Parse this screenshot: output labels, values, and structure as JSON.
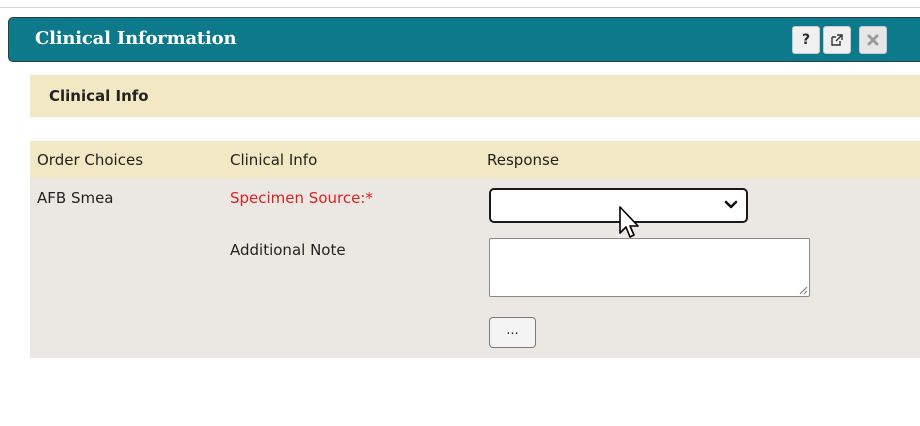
{
  "dialog": {
    "title": "Clinical Information",
    "buttons": {
      "help_label": "?",
      "popout_icon": "popout-icon",
      "close_icon": "close-icon"
    },
    "colors": {
      "titlebar": "#0c7a8a",
      "section_bg": "#f2e8c4",
      "body_bg": "#ebe8e4",
      "required": "#e02020"
    }
  },
  "section": {
    "title": "Clinical Info"
  },
  "table": {
    "headers": [
      "Order Choices",
      "Clinical Info",
      "Response"
    ],
    "row": {
      "order_choice": "AFB Smea",
      "fields": [
        {
          "label": "Specimen Source:*",
          "required": true,
          "type": "select",
          "value": ""
        },
        {
          "label": "Additional Note",
          "required": false,
          "type": "textarea",
          "value": ""
        }
      ],
      "more_button_label": "..."
    }
  },
  "cursor": {
    "icon": "pointer-arrow-icon"
  }
}
